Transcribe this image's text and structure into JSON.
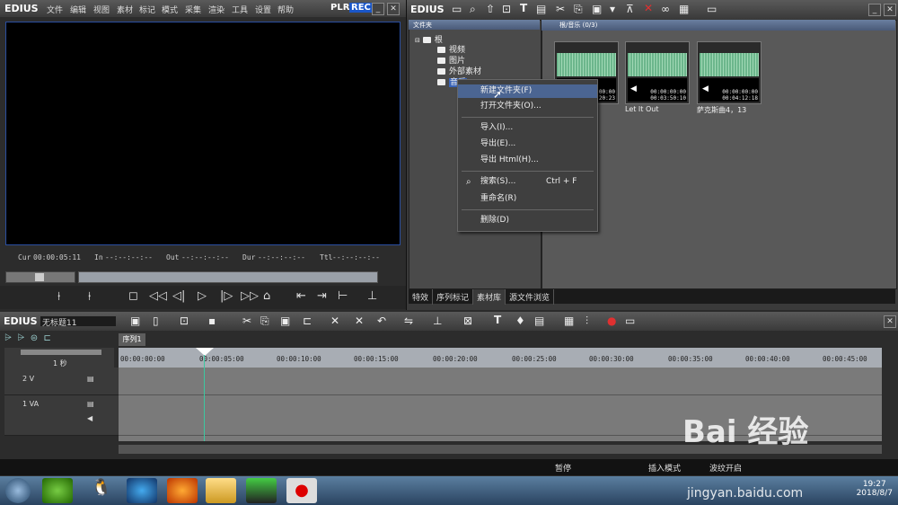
{
  "player": {
    "logo": "EDIUS",
    "menu": [
      "文件",
      "编辑",
      "视图",
      "素材",
      "标记",
      "模式",
      "采集",
      "渲染",
      "工具",
      "设置",
      "帮助"
    ],
    "plr": "PLR",
    "rec": "REC",
    "cur_label": "Cur",
    "cur_value": "00:00:05:11",
    "in_label": "In",
    "in_value": "--:--:--:--",
    "out_label": "Out",
    "out_value": "--:--:--:--",
    "dur_label": "Dur",
    "dur_value": "--:--:--:--",
    "ttl_label": "Ttl",
    "ttl_value": "--:--:--:--"
  },
  "bin": {
    "logo": "EDIUS",
    "folder_header": "文件夹",
    "clip_header": "根/音乐 (0/3)",
    "tree": [
      "根",
      "视频",
      "图片",
      "外部素材",
      "音乐"
    ],
    "clips": [
      {
        "timecode_in": "00:00:00:00",
        "timecode_out": "00:04:20:23",
        "name": ""
      },
      {
        "timecode_in": "00:00:00:00",
        "timecode_out": "00:03:50:10",
        "name": "Let It Out"
      },
      {
        "timecode_in": "00:00:00:00",
        "timecode_out": "00:04:12:18",
        "name": "萨克斯曲4，13"
      }
    ],
    "tabs": [
      "特效",
      "序列标记",
      "素材库",
      "源文件浏览"
    ]
  },
  "context_menu": {
    "items": [
      {
        "label": "新建文件夹(F)",
        "shortcut": ""
      },
      {
        "label": "打开文件夹(O)...",
        "shortcut": ""
      },
      {
        "label": "导入(I)...",
        "shortcut": ""
      },
      {
        "label": "导出(E)...",
        "shortcut": ""
      },
      {
        "label": "导出 Html(H)...",
        "shortcut": ""
      },
      {
        "label": "搜索(S)...",
        "shortcut": "Ctrl + F"
      },
      {
        "label": "重命名(R)",
        "shortcut": ""
      },
      {
        "label": "删除(D)",
        "shortcut": ""
      }
    ]
  },
  "timeline": {
    "logo": "EDIUS",
    "project": "无标题11",
    "sequence_tab": "序列1",
    "scale": "1 秒",
    "ruler": [
      "00:00:00:00",
      "00:00:05:00",
      "00:00:10:00",
      "00:00:15:00",
      "00:00:20:00",
      "00:00:25:00",
      "00:00:30:00",
      "00:00:35:00",
      "00:00:40:00",
      "00:00:45:00"
    ],
    "tracks": [
      "2 V",
      "1 VA"
    ],
    "status_pause": "暂停",
    "status_insert": "插入模式",
    "status_ripple": "波纹开启"
  },
  "taskbar": {
    "time": "19:27",
    "date": "2018/8/7"
  },
  "watermark": {
    "text": "Bai 经验",
    "url": "jingyan.baidu.com"
  },
  "colors": {
    "accent_blue": "#2a4ea0",
    "highlight": "#4b6592",
    "rec_red": "#1a56c8",
    "playhead": "#3cc8a0"
  }
}
